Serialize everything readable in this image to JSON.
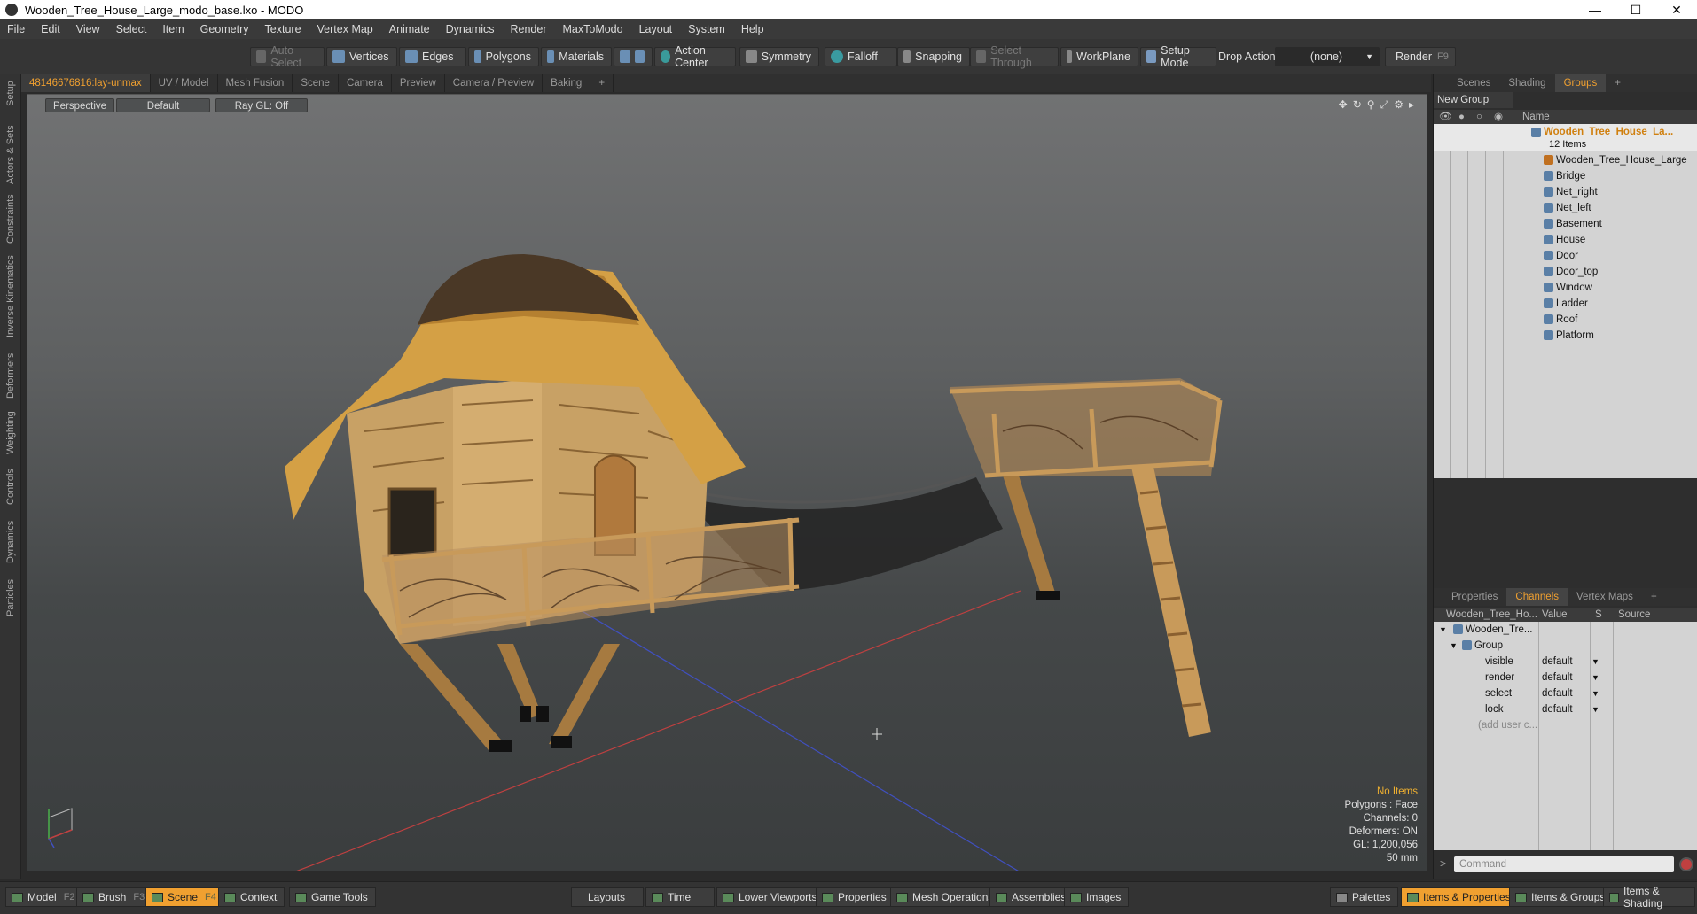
{
  "window": {
    "title": "Wooden_Tree_House_Large_modo_base.lxo - MODO",
    "minimize": "—",
    "maximize": "☐",
    "close": "✕"
  },
  "menu": [
    "File",
    "Edit",
    "View",
    "Select",
    "Item",
    "Geometry",
    "Texture",
    "Vertex Map",
    "Animate",
    "Dynamics",
    "Render",
    "MaxToModo",
    "Layout",
    "System",
    "Help"
  ],
  "toolbar": {
    "auto_select": "Auto Select",
    "vertices": "Vertices",
    "edges": "Edges",
    "polygons": "Polygons",
    "materials": "Materials",
    "action_center": "Action Center",
    "symmetry": "Symmetry",
    "falloff": "Falloff",
    "snapping": "Snapping",
    "select_through": "Select Through",
    "workplane": "WorkPlane",
    "setup_mode": "Setup Mode",
    "drop_action": "Drop Action",
    "drop_value": "(none)",
    "render": "Render",
    "render_key": "F9"
  },
  "left_tabs": [
    "Setup",
    "Actors & Sets",
    "Constraints",
    "Inverse Kinematics",
    "Deformers",
    "Weighting",
    "Controls",
    "Dynamics",
    "Particles"
  ],
  "viewport_tabs": [
    "48146676816:lay-unmax",
    "UV / Model",
    "Mesh Fusion",
    "Scene",
    "Camera",
    "Preview",
    "Camera / Preview",
    "Baking",
    "+"
  ],
  "viewport": {
    "perspective": "Perspective",
    "shading": "Default",
    "raygl": "Ray GL: Off",
    "stats": {
      "no_items": "No Items",
      "polygons": "Polygons : Face",
      "channels": "Channels: 0",
      "deformers": "Deformers: ON",
      "gl": "GL: 1,200,056",
      "mm": "50 mm"
    }
  },
  "scene_tabs": [
    "Scenes",
    "Shading",
    "Groups",
    "+"
  ],
  "groups": {
    "new_group": "New Group",
    "name_header": "Name",
    "root_name": "Wooden_Tree_House_La...",
    "root_count": "12 Items",
    "items": [
      "Wooden_Tree_House_Large",
      "Bridge",
      "Net_right",
      "Net_left",
      "Basement",
      "House",
      "Door",
      "Door_top",
      "Window",
      "Ladder",
      "Roof",
      "Platform"
    ]
  },
  "prop_tabs": [
    "Properties",
    "Channels",
    "Vertex Maps",
    "+"
  ],
  "channels": {
    "col_name": "Wooden_Tree_Ho...",
    "col_value": "Value",
    "col_s": "S",
    "col_source": "Source",
    "item": "Wooden_Tre...",
    "group": "Group",
    "rows": [
      {
        "name": "visible",
        "value": "default"
      },
      {
        "name": "render",
        "value": "default"
      },
      {
        "name": "select",
        "value": "default"
      },
      {
        "name": "lock",
        "value": "default"
      }
    ],
    "add_user": "(add user c..."
  },
  "command_placeholder": "Command",
  "bottom": {
    "model": "Model",
    "model_key": "F2",
    "brush": "Brush",
    "brush_key": "F3",
    "scene": "Scene",
    "scene_key": "F4",
    "context": "Context",
    "game_tools": "Game Tools",
    "layouts": "Layouts",
    "time": "Time",
    "lower_viewports": "Lower Viewports",
    "properties": "Properties",
    "mesh_operations": "Mesh Operations",
    "assemblies": "Assemblies",
    "images": "Images",
    "palettes": "Palettes",
    "items_properties": "Items & Properties",
    "items_groups": "Items & Groups",
    "items_shading": "Items & Shading"
  },
  "colors": {
    "accent": "#f0a030",
    "mesh_icon": "#5a7fa6"
  }
}
